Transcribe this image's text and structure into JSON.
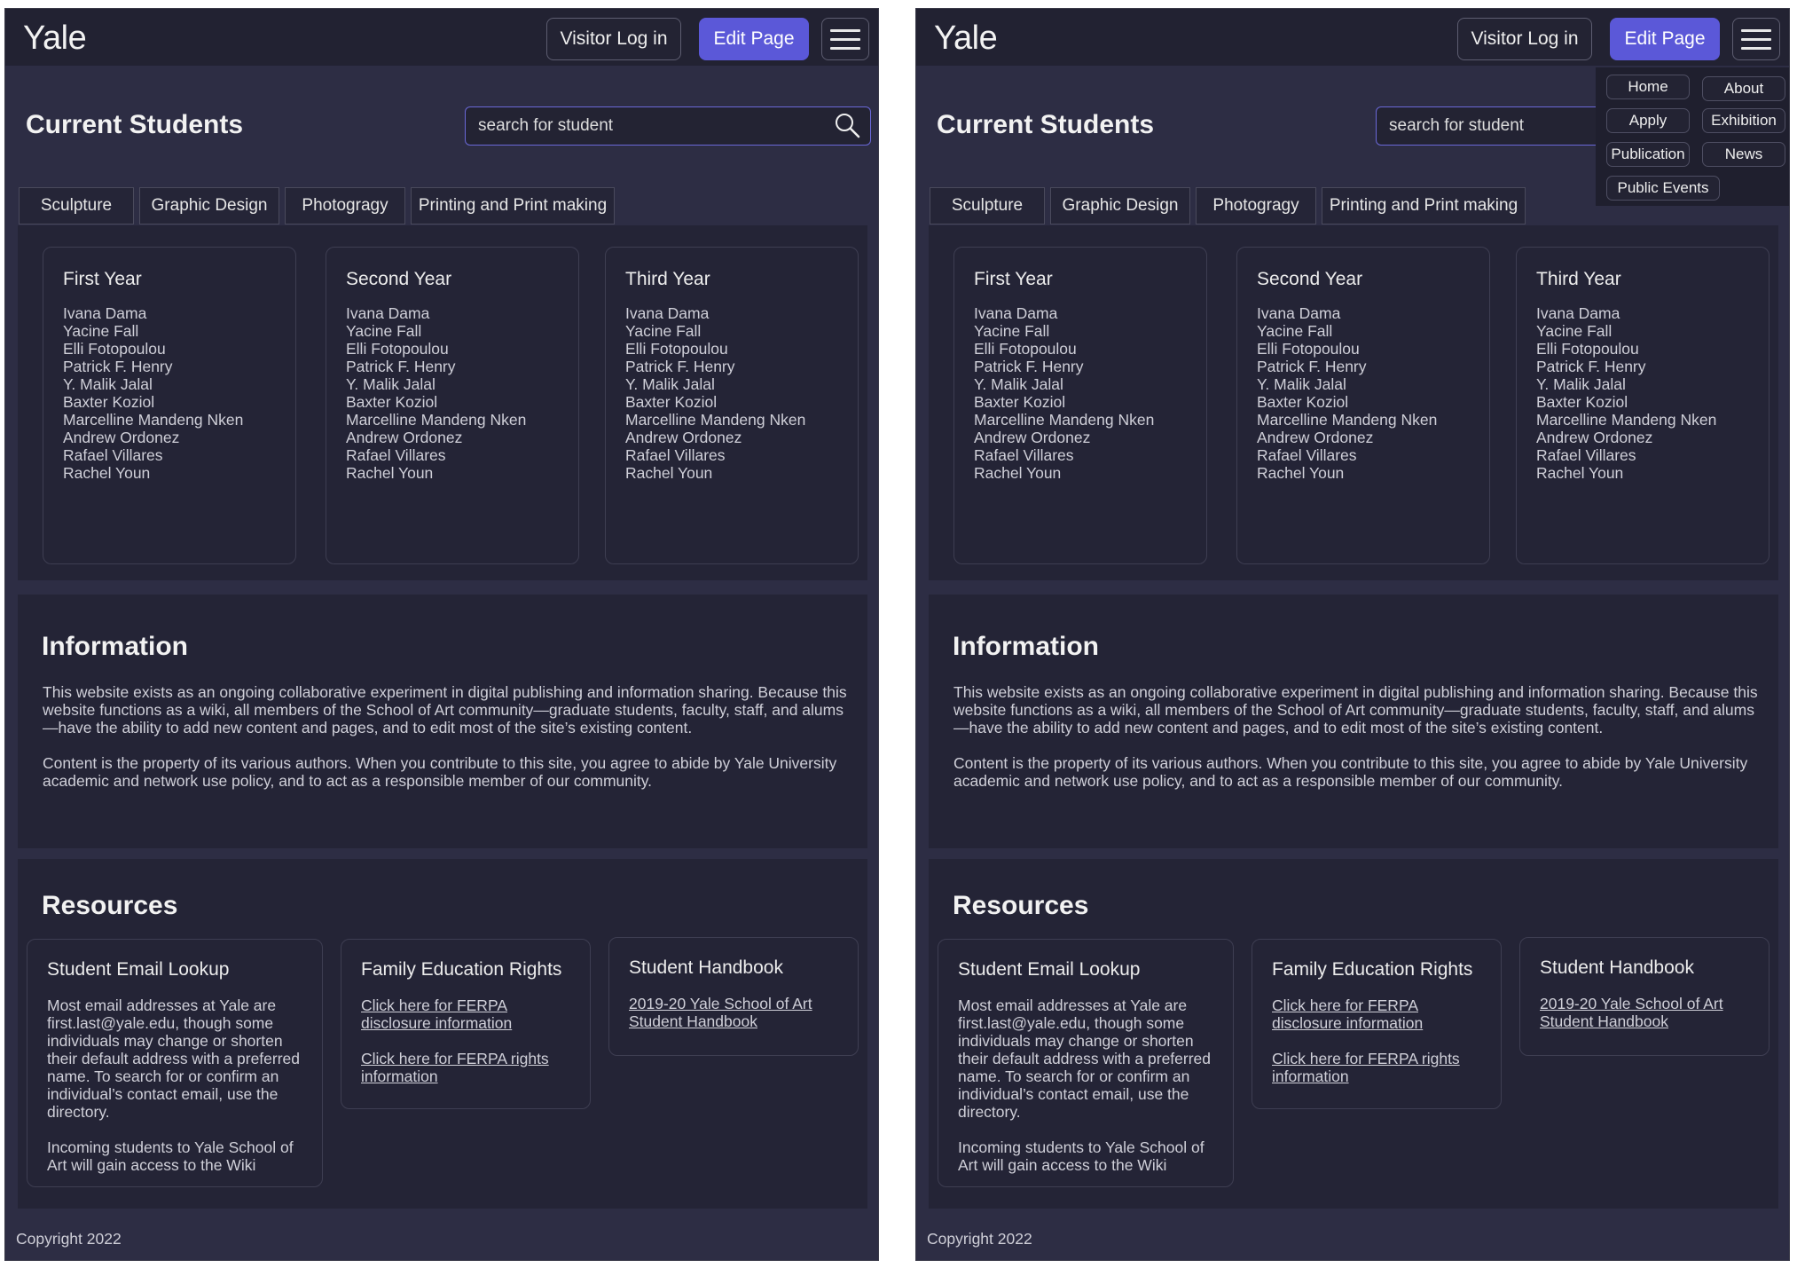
{
  "app": {
    "logo": "Yale",
    "login_label": "Visitor Log in",
    "edit_label": "Edit Page",
    "page_title": "Current Students",
    "search_placeholder": "search for student"
  },
  "tabs": [
    "Sculpture",
    "Graphic Design",
    "Photogragy",
    "Printing and Print making"
  ],
  "years": [
    {
      "title": "First Year",
      "students": [
        "Ivana Dama",
        "Yacine Fall",
        "Elli Fotopoulou",
        "Patrick F. Henry",
        "Y. Malik Jalal",
        "Baxter Koziol",
        "Marcelline Mandeng Nken",
        "Andrew Ordonez",
        "Rafael Villares",
        "Rachel Youn"
      ]
    },
    {
      "title": "Second Year",
      "students": [
        "Ivana Dama",
        "Yacine Fall",
        "Elli Fotopoulou",
        "Patrick F. Henry",
        "Y. Malik Jalal",
        "Baxter Koziol",
        "Marcelline Mandeng Nken",
        "Andrew Ordonez",
        "Rafael Villares",
        "Rachel Youn"
      ]
    },
    {
      "title": "Third Year",
      "students": [
        "Ivana Dama",
        "Yacine Fall",
        "Elli Fotopoulou",
        "Patrick F. Henry",
        "Y. Malik Jalal",
        "Baxter Koziol",
        "Marcelline Mandeng Nken",
        "Andrew Ordonez",
        "Rafael Villares",
        "Rachel Youn"
      ]
    }
  ],
  "info": {
    "heading": "Information",
    "p1": "This website exists as an ongoing collaborative experiment in digital publishing and information sharing. Because this website functions as a wiki, all members of the School of Art community—graduate students, faculty, staff, and alums—have the ability to add new content and pages, and to edit most of the site’s existing content.",
    "p2": "Content is the property of its various authors. When you contribute to this site, you agree to abide by Yale University academic and network use policy, and to act as a responsible member of our community."
  },
  "resources": {
    "heading": "Resources",
    "email": {
      "title": "Student Email Lookup",
      "body1": "Most email addresses at Yale are first.last@yale.edu, though some individuals may change or shorten their default address with a preferred name. To search for or confirm an individual’s contact email, use the directory.",
      "body2": "Incoming students to Yale School of Art will gain access to the Wiki"
    },
    "ferpa": {
      "title": "Family Education Rights",
      "link1": "Click here for FERPA disclosure information",
      "link2": "Click here for FERPA rights information"
    },
    "handbook": {
      "title": "Student Handbook",
      "link": "2019-20 Yale School of Art Student Handbook"
    }
  },
  "footer": {
    "copyright": "Copyright 2022"
  },
  "menu": {
    "items": [
      "Home",
      "About",
      "Apply",
      "Exhibition",
      "Publication",
      "News",
      "Public Events"
    ]
  },
  "colors": {
    "accent": "#5b58d8",
    "background": "#2d2d44",
    "header": "#222232"
  }
}
